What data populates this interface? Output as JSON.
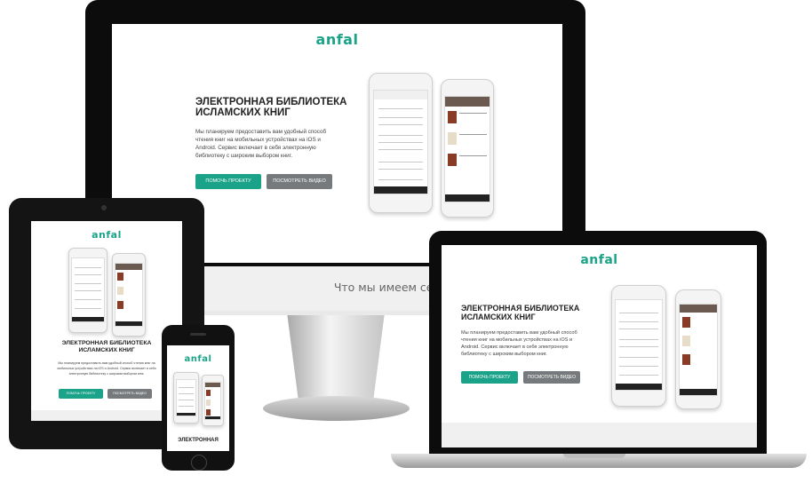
{
  "site": {
    "logo": "anfal",
    "heading_line1": "ЭЛЕКТРОННАЯ БИБЛИОТЕКА",
    "heading_line2": "ИСЛАМСКИХ КНИГ",
    "description": "Мы планируем предоставить вам удобный способ чтения книг на мобильных устройствах на iOS и Android. Сервис включает в себя электронную библиотеку с широким выбором книг.",
    "btn_help": "ПОМОЧЬ ПРОЕКТУ",
    "btn_video": "ПОСМОТРЕТЬ ВИДЕО",
    "section_title": "Что мы имеем сейчас?",
    "phone_heading_partial": "ЭЛЕКТРОННАЯ"
  },
  "colors": {
    "accent": "#1aa389",
    "button_gray": "#777a7c",
    "app_bar": "#6b5a4f",
    "book_cover": "#8a3b26"
  },
  "icons": {
    "nav_back": "triangle-left",
    "nav_home": "circle",
    "nav_recent": "square"
  }
}
